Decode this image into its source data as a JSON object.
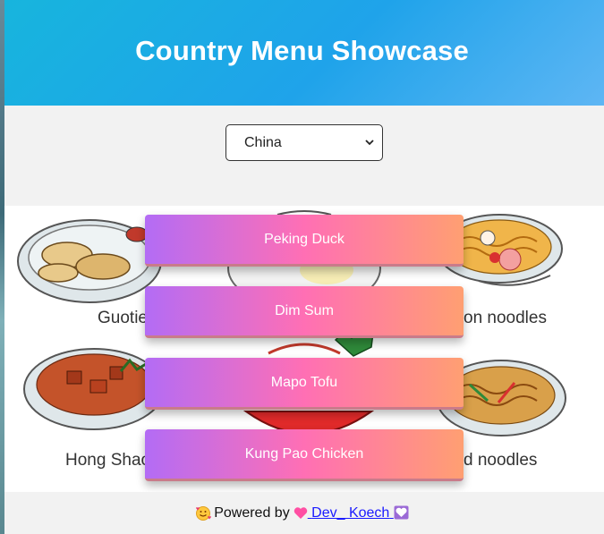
{
  "header": {
    "title": "Country Menu Showcase"
  },
  "selector": {
    "selected": "China",
    "icon": "chevron-down-icon"
  },
  "background_labels": {
    "top_left": "Guotie",
    "top_right": "on noodles",
    "bottom_left": "Hong Shao",
    "bottom_right": "d noodles"
  },
  "menu": {
    "items": [
      {
        "label": "Peking Duck"
      },
      {
        "label": "Dim Sum"
      },
      {
        "label": "Mapo Tofu"
      },
      {
        "label": "Kung Pao Chicken"
      }
    ]
  },
  "footer": {
    "prefix": "Powered by",
    "link_text": "Dev_ Koech",
    "icons": [
      "smiling-face-with-hearts-icon",
      "heart-icon",
      "purple-heart-icon"
    ]
  },
  "colors": {
    "header_start": "#17b5dd",
    "header_end": "#5eb6f4",
    "button_start": "#b36cf5",
    "button_mid": "#ff6fb4",
    "button_end": "#ff9f72"
  }
}
